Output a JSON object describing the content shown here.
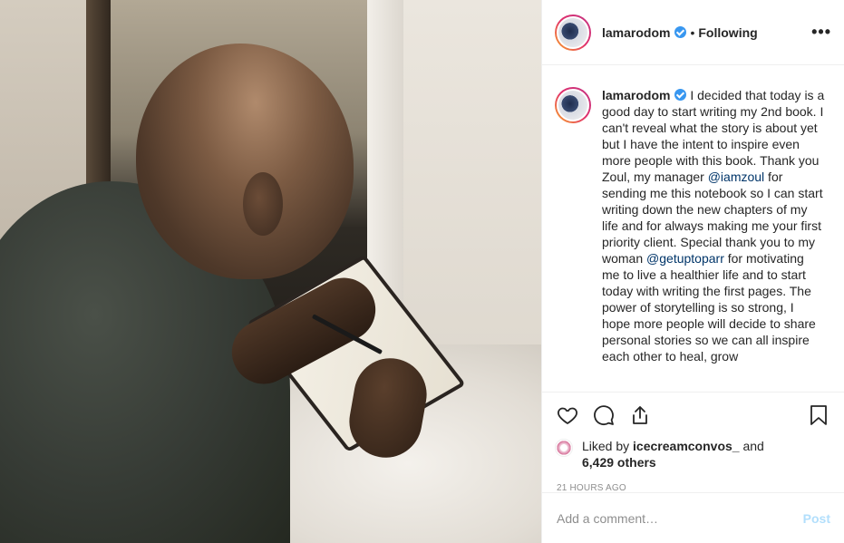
{
  "header": {
    "username": "lamarodom",
    "separator": "•",
    "follow_status": "Following",
    "more_label": "•••"
  },
  "caption": {
    "username": "lamarodom",
    "text_1": " I decided that today is a good day to start writing my 2nd book. I can't reveal what the story is about yet but I have the intent to inspire even more people with this book. Thank you Zoul, my manager ",
    "mention_1": "@iamzoul",
    "text_2": " for sending me this notebook so I can start writing down the new chapters of my life and for always making me your first priority client. Special thank you to my woman ",
    "mention_2": "@getuptoparr",
    "text_3": " for motivating me to live a healthier life and to start today with writing the first pages. The power of storytelling is so strong, I hope more people will decide to share personal stories so we can all inspire each other to heal, grow"
  },
  "actions": {
    "like_icon": "heart-icon",
    "comment_icon": "comment-icon",
    "share_icon": "share-icon",
    "save_icon": "bookmark-icon"
  },
  "likes": {
    "prefix": "Liked by ",
    "liker": "icecreamconvos_",
    "middle": " and",
    "count": "6,429 others"
  },
  "timestamp": "21 HOURS AGO",
  "comment_box": {
    "placeholder": "Add a comment…",
    "post_label": "Post"
  },
  "colors": {
    "verified": "#3897f0",
    "mention": "#003569",
    "post_disabled": "#b2dffc",
    "muted": "#8e8e8e"
  }
}
